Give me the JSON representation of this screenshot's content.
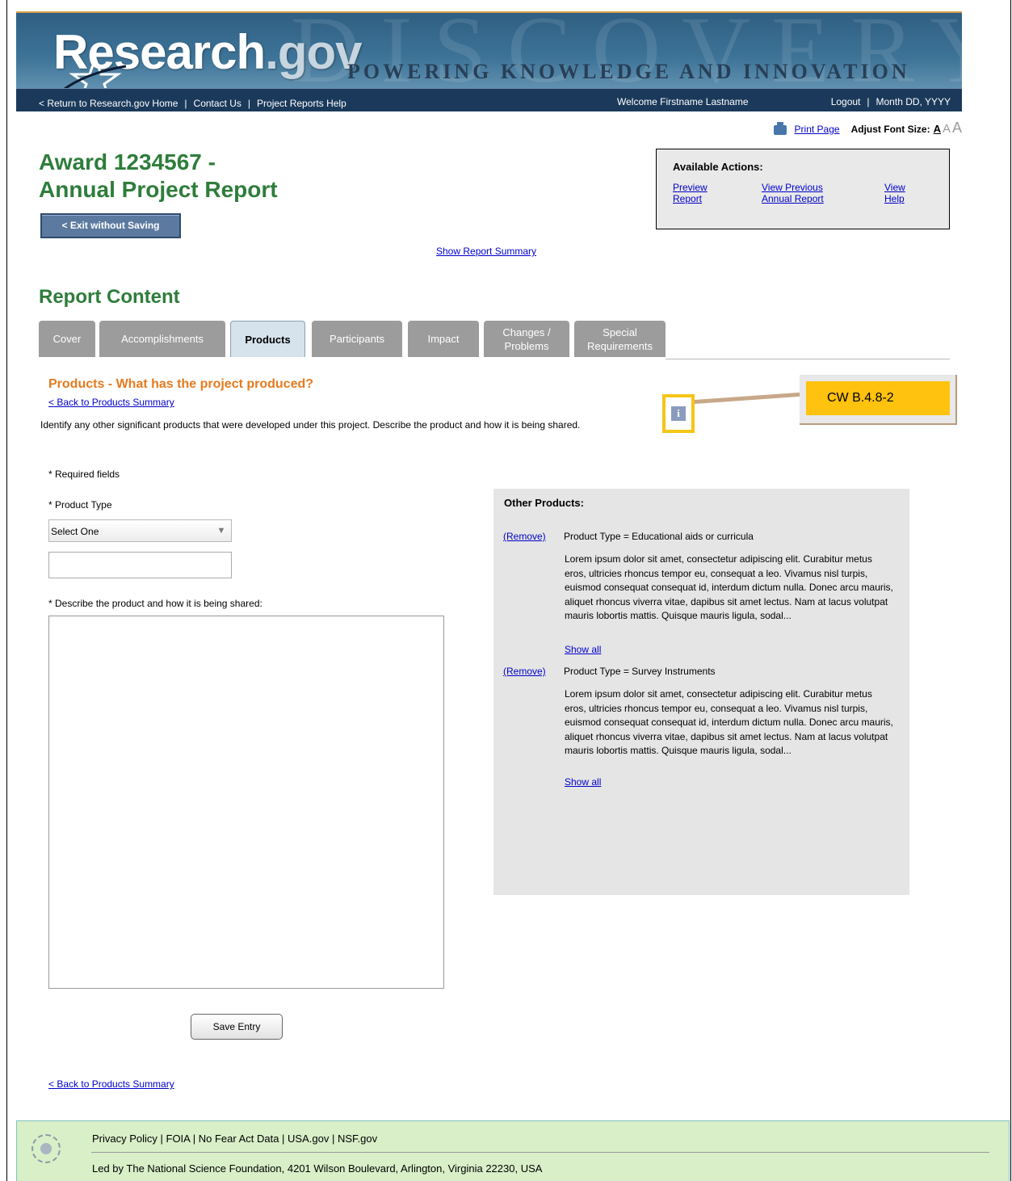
{
  "header": {
    "logo_main": "Research",
    "logo_gov": ".gov",
    "bg_word": "DISCOVERY",
    "tagline": "POWERING KNOWLEDGE AND INNOVATION",
    "nav_left": [
      "< Return to Research.gov Home",
      "Contact Us",
      "Project Reports Help"
    ],
    "welcome": "Welcome Firstname Lastname",
    "logout": "Logout",
    "date": "Month DD, YYYY"
  },
  "toolbar": {
    "print_page": "Print Page",
    "adjust_font_label": "Adjust Font Size:",
    "font_small": "A",
    "font_medium": "A",
    "font_large": "A"
  },
  "award": {
    "title_line1": "Award 1234567 -",
    "title_line2": "Annual Project Report"
  },
  "actions": {
    "title": "Available Actions:",
    "preview_1": "Preview",
    "preview_2": "Report",
    "view_prev_1": "View Previous",
    "view_prev_2": "Annual Report",
    "view_help_1": "View",
    "view_help_2": "Help"
  },
  "exit_button": "< Exit without Saving",
  "show_summary": "Show Report Summary",
  "section_title": "Report Content",
  "tabs": [
    {
      "l1": "Cover",
      "l2": ""
    },
    {
      "l1": "Accomplishments",
      "l2": ""
    },
    {
      "l1": "Products",
      "l2": ""
    },
    {
      "l1": "Participants",
      "l2": ""
    },
    {
      "l1": "Impact",
      "l2": ""
    },
    {
      "l1": "Changes /",
      "l2": "Problems"
    },
    {
      "l1": "Special",
      "l2": "Requirements"
    }
  ],
  "products": {
    "heading": "Products - What has the project produced?",
    "back_link": "< Back to Products Summary",
    "instruction": "Identify any other significant products that were developed under this project. Describe the product and how it is being shared.",
    "info_icon": "i",
    "annotation": "CW B.4.8-2"
  },
  "form": {
    "required_note": "* Required fields",
    "product_type_label": "* Product Type",
    "product_type_value": "Select One",
    "describe_label": "* Describe the product and how it is being shared:",
    "save_button": "Save Entry"
  },
  "other_products": {
    "title": "Other Products:",
    "items": [
      {
        "remove": "(Remove)",
        "type": "Product Type = Educational aids or curricula",
        "desc": "Lorem ipsum dolor sit amet, consectetur adipiscing elit. Curabitur metus eros, ultricies rhoncus tempor eu, consequat a leo. Vivamus nisl turpis, euismod consequat consequat id, interdum dictum nulla. Donec arcu mauris, aliquet rhoncus viverra vitae, dapibus sit amet lectus. Nam at lacus volutpat mauris lobortis mattis. Quisque mauris ligula, sodal...",
        "show_all": "Show all"
      },
      {
        "remove": "(Remove)",
        "type": "Product Type = Survey Instruments",
        "desc": "Lorem ipsum dolor sit amet, consectetur adipiscing elit. Curabitur metus eros, ultricies rhoncus tempor eu, consequat a leo. Vivamus nisl turpis, euismod consequat consequat id, interdum dictum nulla. Donec arcu mauris, aliquet rhoncus viverra vitae, dapibus sit amet lectus. Nam at lacus volutpat mauris lobortis mattis. Quisque mauris ligula, sodal...",
        "show_all": "Show all"
      }
    ]
  },
  "footer": {
    "links": "Privacy Policy | FOIA | No Fear Act Data | USA.gov | NSF.gov",
    "address": "Led by The National Science Foundation, 4201 Wilson Boulevard, Arlington, Virginia 22230, USA"
  },
  "colors": {
    "title_green": "#2e7d3b",
    "heading_orange": "#e57a1f",
    "annotation_yellow": "#ffc20e",
    "tab_gray": "#9c9c9c"
  }
}
